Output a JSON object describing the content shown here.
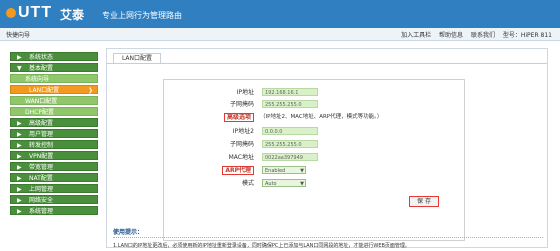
{
  "header": {
    "logo_text": "UTT",
    "brand_name": "艾泰",
    "slogan": "专业上网行为管理路由"
  },
  "menubar": {
    "quick_label": "快捷向导",
    "links": [
      "加入工具栏",
      "帮助信息",
      "联系我们",
      "型号：HiPER 811"
    ]
  },
  "sidebar": {
    "items": [
      {
        "label": "系统状态",
        "type": "main"
      },
      {
        "label": "基本配置",
        "type": "main"
      },
      {
        "label": "系统向导",
        "type": "sub"
      },
      {
        "label": "LAN口配置",
        "type": "active"
      },
      {
        "label": "WAN口配置",
        "type": "sub"
      },
      {
        "label": "DHCP配置",
        "type": "sub"
      },
      {
        "label": "高级配置",
        "type": "main"
      },
      {
        "label": "用户管理",
        "type": "main"
      },
      {
        "label": "转发控制",
        "type": "main"
      },
      {
        "label": "VPN配置",
        "type": "main"
      },
      {
        "label": "带宽管理",
        "type": "main"
      },
      {
        "label": "NAT配置",
        "type": "main"
      },
      {
        "label": "上网管理",
        "type": "main"
      },
      {
        "label": "网络安全",
        "type": "main"
      },
      {
        "label": "系统管理",
        "type": "main"
      }
    ]
  },
  "panel": {
    "tab_label": "LAN口配置",
    "fields": {
      "ip_label": "IP地址",
      "ip_value": "192.168.16.1",
      "mask_label": "子网掩码",
      "mask_value": "255.255.255.0",
      "advanced_label": "高级选项",
      "advanced_note": "（IP地址2、MAC地址、ARP代理，模式等功能。）",
      "ip2_label": "IP地址2",
      "ip2_value": "0.0.0.0",
      "mask2_label": "子网掩码",
      "mask2_value": "255.255.255.0",
      "mac_label": "MAC地址",
      "mac_value": "0022aa397949",
      "arp_label": "ARP代理",
      "arp_value": "Enabled",
      "mode_label": "模式",
      "mode_value": "Auto"
    },
    "save_label": "保 存",
    "tips_title": "使用提示：",
    "tips_text": "1.LAN口的IP地址更改后，必须使用新的IP地址重新登录设备，同时确保PC上已添加与LAN口同网段的地址，才能进行WEB页面管理。"
  },
  "colors": {
    "header_blue": "#2f7fc1",
    "nav_green": "#4a8f3c",
    "nav_sub_green": "#8fc76a",
    "nav_active_orange": "#f39a1e",
    "highlight_red": "#e53935"
  }
}
